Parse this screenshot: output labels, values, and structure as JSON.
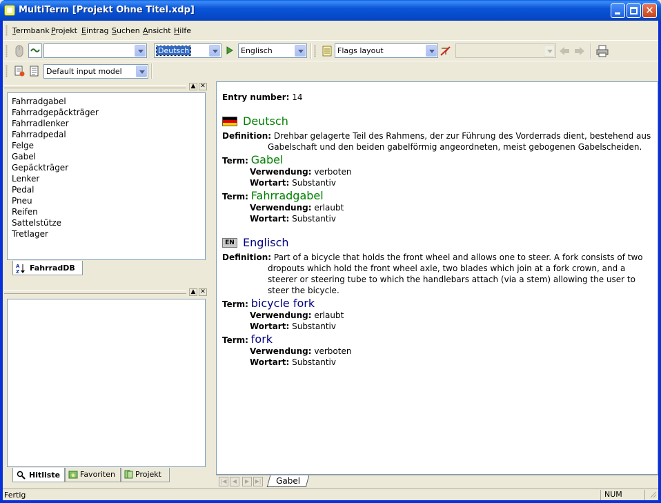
{
  "window": {
    "title": "MultiTerm [Projekt Ohne Titel.xdp]"
  },
  "menu": {
    "items": [
      "Termbank",
      "Projekt",
      "Eintrag",
      "Suchen",
      "Ansicht",
      "Hilfe"
    ],
    "mnemonics": [
      "T",
      "P",
      "E",
      "S",
      "A",
      "H"
    ]
  },
  "toolbar": {
    "search_value": "",
    "source_language": "Deutsch",
    "target_language": "Englisch",
    "layout": "Flags layout",
    "filter_value": "",
    "input_model": "Default input model"
  },
  "term_list": {
    "items": [
      "Fahrradgabel",
      "Fahrradgepäckträger",
      "Fahrradlenker",
      "Fahrradpedal",
      "Felge",
      "Gabel",
      "Gepäckträger",
      "Lenker",
      "Pedal",
      "Pneu",
      "Reifen",
      "Sattelstütze",
      "Tretlager"
    ],
    "tab_label": "FahrradDB"
  },
  "lower_pane": {
    "tabs": [
      "Hitliste",
      "Favoriten",
      "Projekt"
    ]
  },
  "entry": {
    "number_label": "Entry number:",
    "number": "14",
    "definition_label": "Definition:",
    "term_label": "Term:",
    "usage_label": "Verwendung:",
    "pos_label": "Wortart:",
    "german": {
      "language": "Deutsch",
      "definition_line1": "Drehbar gelagerte Teil des Rahmens, der zur Führung des Vorderrads dient, bestehend aus",
      "definition_line2": "Gabelschaft und den beiden gabelförmig angeordneten, meist gebogenen Gabelscheiden.",
      "terms": [
        {
          "term": "Gabel",
          "usage": "verboten",
          "pos": "Substantiv"
        },
        {
          "term": "Fahrradgabel",
          "usage": "erlaubt",
          "pos": "Substantiv"
        }
      ]
    },
    "english": {
      "language": "Englisch",
      "flag_code": "EN",
      "definition_line1": "Part of a bicycle that holds the front wheel and allows one to steer. A fork consists of two",
      "definition_line2": "dropouts which hold the front wheel axle, two blades which join at a fork crown, and a",
      "definition_line3": "steerer or steering tube to which the handlebars attach (via a stem) allowing the user to",
      "definition_line4": "steer the bicycle.",
      "terms": [
        {
          "term": "bicycle fork",
          "usage": "erlaubt",
          "pos": "Substantiv"
        },
        {
          "term": "fork",
          "usage": "verboten",
          "pos": "Substantiv"
        }
      ]
    }
  },
  "doc_tab": "Gabel",
  "status": {
    "text": "Fertig",
    "num": "NUM"
  },
  "colors": {
    "german_term": "#008000",
    "english_term": "#000080",
    "titlebar": "#0a56d8"
  }
}
